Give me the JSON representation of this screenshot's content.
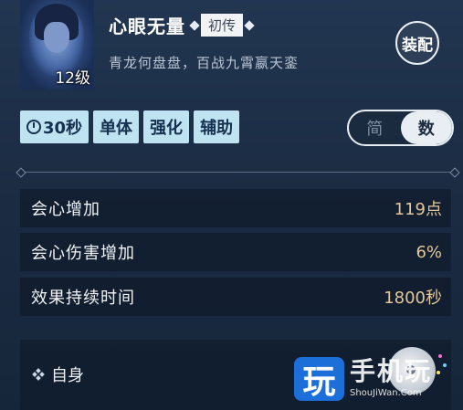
{
  "header": {
    "skill_name": "心眼无量",
    "tier": "初传",
    "subtitle": "青龙何盘盘，百战九霄嬴天銮",
    "level": "12级",
    "equip_label": "装配"
  },
  "tags": [
    {
      "label": "30秒",
      "icon": "clock-icon"
    },
    {
      "label": "单体"
    },
    {
      "label": "强化"
    },
    {
      "label": "辅助"
    }
  ],
  "view_toggle": {
    "simple": "简",
    "numeric": "数",
    "selected": "数"
  },
  "stats": [
    {
      "label": "会心增加",
      "value": "119点"
    },
    {
      "label": "会心伤害增加",
      "value": "6%"
    },
    {
      "label": "效果持续时间",
      "value": "1800秒"
    }
  ],
  "target": {
    "label": "自身"
  },
  "watermark": {
    "logo_char": "玩",
    "site_name": "手机玩",
    "url": "ShouJiWan.Com"
  },
  "colors": {
    "accent": "#bfe3f0",
    "value_gold": "#e2c79a",
    "watermark_blue": "#1c6fd8"
  }
}
